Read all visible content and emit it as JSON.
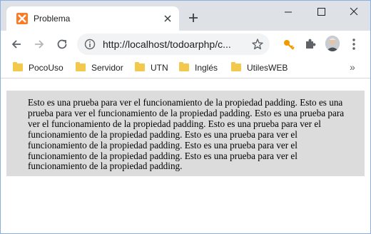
{
  "tab": {
    "title": "Problema"
  },
  "address_bar": {
    "url": "http://localhost/todoarphp/c..."
  },
  "bookmarks": [
    {
      "label": "PocoUso"
    },
    {
      "label": "Servidor"
    },
    {
      "label": "UTN"
    },
    {
      "label": "Inglés"
    },
    {
      "label": "UtilesWEB"
    }
  ],
  "page": {
    "paragraph": "Esto es una prueba para ver el funcionamiento de la propiedad padding. Esto es una prueba para ver el funcionamiento de la propiedad padding. Esto es una prueba para ver el funcionamiento de la propiedad padding. Esto es una prueba para ver el funcionamiento de la propiedad padding. Esto es una prueba para ver el funcionamiento de la propiedad padding. Esto es una prueba para ver el funcionamiento de la propiedad padding. Esto es una prueba para ver el funcionamiento de la propiedad padding."
  },
  "icons": {
    "favicon": "xampp-icon",
    "tab_close": "close-icon",
    "new_tab": "plus-icon",
    "back": "arrow-left-icon",
    "forward": "arrow-right-icon",
    "reload": "reload-icon",
    "site_info": "info-icon",
    "bookmark_star": "star-icon",
    "key_extension": "key-icon",
    "extensions": "puzzle-icon",
    "menu": "kebab-menu-icon"
  },
  "colors": {
    "tabstrip": "#dee1e6",
    "omnibox": "#f1f3f4",
    "favicon": "#fb7a24",
    "content_box": "#dcdcdc",
    "key_icon": "#f29900"
  }
}
